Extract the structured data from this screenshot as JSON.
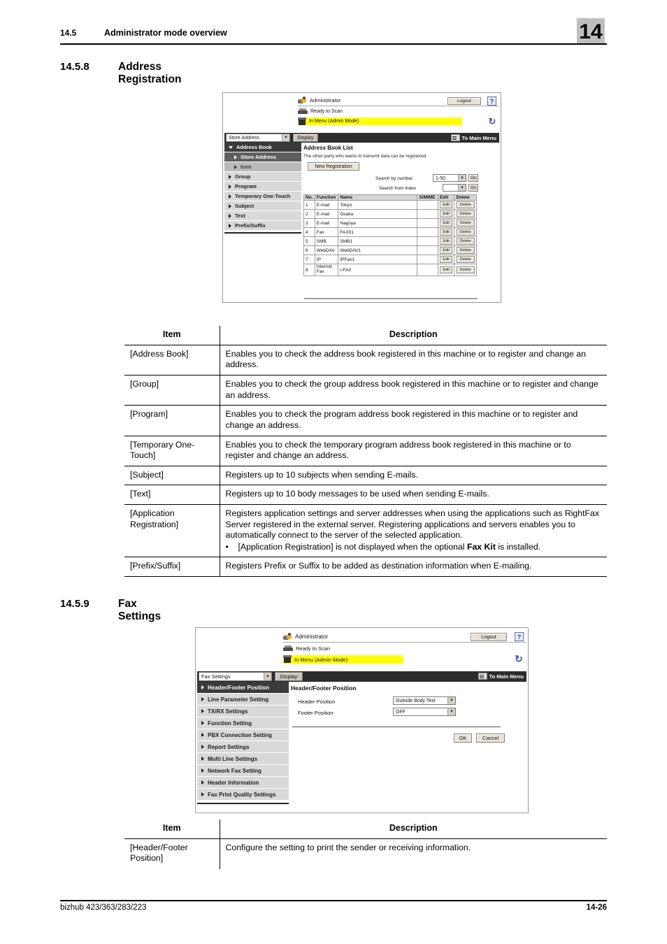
{
  "running_head": {
    "section_number": "14.5",
    "section_title": "Administrator mode overview",
    "chapter_tab": "14"
  },
  "sections": [
    {
      "number": "14.5.8",
      "title": "Address Registration"
    },
    {
      "number": "14.5.9",
      "title": "Fax Settings"
    }
  ],
  "screenshot_address": {
    "admin_label": "Administrator",
    "logout_label": "Logout",
    "help_label": "?",
    "status_scan": "Ready to Scan",
    "status_menu": "In Menu (Admin Mode)",
    "refresh_icon": "refresh-icon",
    "menu_select_value": "Store Address",
    "display_button": "Display",
    "to_main_menu": "To Main Menu",
    "nav": [
      {
        "label": "Address Book",
        "style": "dark",
        "marker": "triangle-down"
      },
      {
        "label": "Store Address",
        "style": "mid",
        "marker": "triangle-right"
      },
      {
        "label": "Icon",
        "style": "sub",
        "marker": "triangle-right"
      },
      {
        "label": "Group",
        "style": "light",
        "marker": "triangle-right"
      },
      {
        "label": "Program",
        "style": "light",
        "marker": "triangle-right"
      },
      {
        "label": "Temporary One-Touch",
        "style": "light",
        "marker": "triangle-right"
      },
      {
        "label": "Subject",
        "style": "light",
        "marker": "triangle-right"
      },
      {
        "label": "Text",
        "style": "light",
        "marker": "triangle-right"
      },
      {
        "label": "Prefix/Suffix",
        "style": "light",
        "marker": "triangle-right"
      }
    ],
    "content_title": "Address Book List",
    "content_desc": "The other party who wants to transmit data can be registered.",
    "new_registration": "New Registration",
    "search_by_number_label": "Search by number.",
    "search_by_number_value": "1-50",
    "search_from_index_label": "Search from Index",
    "search_from_index_value": "",
    "go_label": "Go",
    "table_headers": [
      "No.",
      "Function",
      "Name",
      "S/MIME",
      "Edit",
      "Delete"
    ],
    "edit_label": "Edit",
    "delete_label": "Delete",
    "rows": [
      {
        "no": "1",
        "function": "E-mail",
        "name": "Tokyo",
        "smime": ""
      },
      {
        "no": "2",
        "function": "E-mail",
        "name": "Osaka",
        "smime": ""
      },
      {
        "no": "3",
        "function": "E-mail",
        "name": "Nagoya",
        "smime": ""
      },
      {
        "no": "4",
        "function": "Fax",
        "name": "FAX01",
        "smime": ""
      },
      {
        "no": "5",
        "function": "SMB",
        "name": "SMB1",
        "smime": ""
      },
      {
        "no": "6",
        "function": "WebDAV",
        "name": "WebDAV1",
        "smime": ""
      },
      {
        "no": "7",
        "function": "IP",
        "name": "IPFax1",
        "smime": ""
      },
      {
        "no": "8",
        "function": "Internet Fax",
        "name": "I-FAX",
        "smime": ""
      }
    ]
  },
  "table_address": {
    "headers": [
      "Item",
      "Description"
    ],
    "rows": [
      {
        "item": "[Address Book]",
        "desc": "Enables you to check the address book registered in this machine or to register and change an address."
      },
      {
        "item": "[Group]",
        "desc": "Enables you to check the group address book registered in this machine or to register and change an address."
      },
      {
        "item": "[Program]",
        "desc": "Enables you to check the program address book registered in this machine or to register and change an address."
      },
      {
        "item": "[Temporary One-Touch]",
        "desc": "Enables you to check the temporary program address book registered in this machine or to register and change an address."
      },
      {
        "item": "[Subject]",
        "desc": "Registers up to 10 subjects when sending E-mails."
      },
      {
        "item": "[Text]",
        "desc": "Registers up to 10 body messages to be used when sending E-mails."
      },
      {
        "item": "[Application Registration]",
        "desc": "Registers application settings and server addresses when using the applications such as RightFax Server registered in the external server. Registering applications and servers enables you to automatically connect to the server of the selected application.",
        "bullet_pre": "[Application Registration] is not displayed when the optional ",
        "bullet_bold": "Fax Kit",
        "bullet_post": " is installed."
      },
      {
        "item": "[Prefix/Suffix]",
        "desc": "Registers Prefix or Suffix to be added as destination information when E-mailing."
      }
    ]
  },
  "screenshot_fax": {
    "admin_label": "Administrator",
    "logout_label": "Logout",
    "help_label": "?",
    "status_scan": "Ready to Scan",
    "status_menu": "In Menu (Admin Mode)",
    "refresh_icon": "refresh-icon",
    "menu_select_value": "Fax Settings",
    "display_button": "Display",
    "to_main_menu": "To Main Menu",
    "nav": [
      {
        "label": "Header/Footer Position",
        "style": "dark",
        "marker": "triangle-right"
      },
      {
        "label": "Line Parameter Setting",
        "style": "light",
        "marker": "triangle-right"
      },
      {
        "label": "TX/RX Settings",
        "style": "light",
        "marker": "triangle-right"
      },
      {
        "label": "Function Setting",
        "style": "light",
        "marker": "triangle-right"
      },
      {
        "label": "PBX Connection Setting",
        "style": "light",
        "marker": "triangle-right"
      },
      {
        "label": "Report Settings",
        "style": "light",
        "marker": "triangle-right"
      },
      {
        "label": "Multi Line Settings",
        "style": "light",
        "marker": "triangle-right"
      },
      {
        "label": "Network Fax Setting",
        "style": "light",
        "marker": "triangle-right"
      },
      {
        "label": "Header Information",
        "style": "light",
        "marker": "triangle-right"
      },
      {
        "label": "Fax Print Quality Settings",
        "style": "light",
        "marker": "triangle-right"
      }
    ],
    "content_title": "Header/Footer Position",
    "fields": [
      {
        "label": "Header Position",
        "value": "Outside Body Text"
      },
      {
        "label": "Footer Position",
        "value": "OFF"
      }
    ],
    "ok_label": "OK",
    "cancel_label": "Cancel"
  },
  "table_fax": {
    "headers": [
      "Item",
      "Description"
    ],
    "rows": [
      {
        "item": "[Header/Footer Position]",
        "desc": "Configure the setting to print the sender or receiving information."
      }
    ]
  },
  "footer": {
    "product": "bizhub 423/363/283/223",
    "page": "14-26"
  }
}
